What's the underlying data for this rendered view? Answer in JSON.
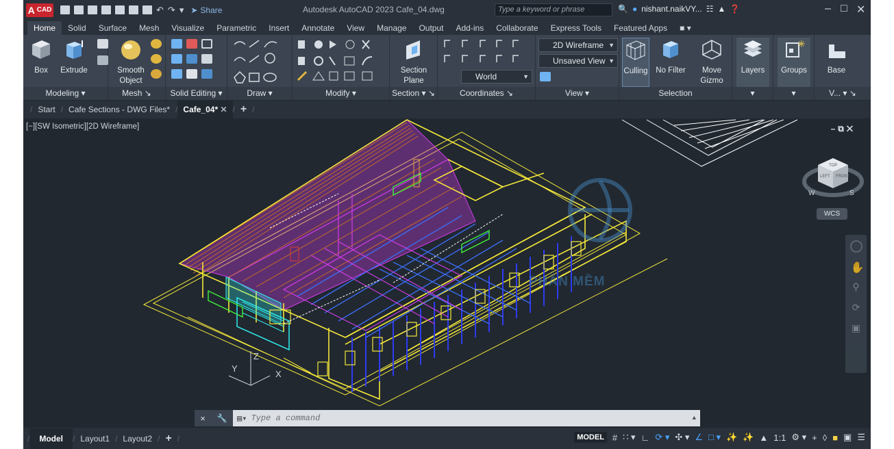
{
  "app": {
    "badge": "CAD",
    "title": "Autodesk AutoCAD 2023   Cafe_04.dwg",
    "share_label": "Share",
    "search_placeholder": "Type a keyword or phrase",
    "user": "nishant.naikVY..."
  },
  "ribbon_tabs": [
    "Home",
    "Solid",
    "Surface",
    "Mesh",
    "Visualize",
    "Parametric",
    "Insert",
    "Annotate",
    "View",
    "Manage",
    "Output",
    "Add-ins",
    "Collaborate",
    "Express Tools",
    "Featured Apps"
  ],
  "ribbon": {
    "modeling": {
      "title": "Modeling",
      "box": "Box",
      "extrude": "Extrude"
    },
    "mesh": {
      "title": "Mesh",
      "smooth": "Smooth",
      "object": "Object"
    },
    "solid_editing": {
      "title": "Solid Editing"
    },
    "draw": {
      "title": "Draw"
    },
    "modify": {
      "title": "Modify"
    },
    "section": {
      "title": "Section",
      "plane1": "Section",
      "plane2": "Plane"
    },
    "coordinates": {
      "title": "Coordinates",
      "world": "World"
    },
    "view": {
      "title": "View",
      "visual_style": "2D Wireframe",
      "saved_view": "Unsaved View"
    },
    "selection": {
      "title": "Selection",
      "culling": "Culling",
      "no_filter": "No Filter",
      "move": "Move",
      "gizmo": "Gizmo"
    },
    "layers": "Layers",
    "groups": "Groups",
    "base": "Base",
    "v": "V..."
  },
  "file_tabs": [
    "Start",
    "Cafe Sections - DWG Files*",
    "Cafe_04*"
  ],
  "viewport": {
    "label": "[−][SW Isometric][2D Wireframe]",
    "wcs": "WCS",
    "cube_top": "TOP",
    "cube_left": "LEFT",
    "cube_front": "FRONT",
    "compass_w": "W",
    "compass_s": "S",
    "watermark": "PHẦN MỀM"
  },
  "command": {
    "placeholder": "Type a command"
  },
  "layout_tabs": [
    "Model",
    "Layout1",
    "Layout2"
  ],
  "status": {
    "space": "MODEL",
    "scale": "1:1"
  },
  "colors": {
    "ribbon_bg": "#3b4450",
    "viewport_bg": "#212830",
    "wire_yellow": "#f5e83a",
    "wire_magenta": "#d23ce8",
    "wire_blue": "#2e3cf0",
    "wire_cyan": "#2ef0f0",
    "wire_green": "#41e63a",
    "wire_red": "#e0392f",
    "wire_white": "#ffffff",
    "wire_orange": "#e0a33c"
  }
}
